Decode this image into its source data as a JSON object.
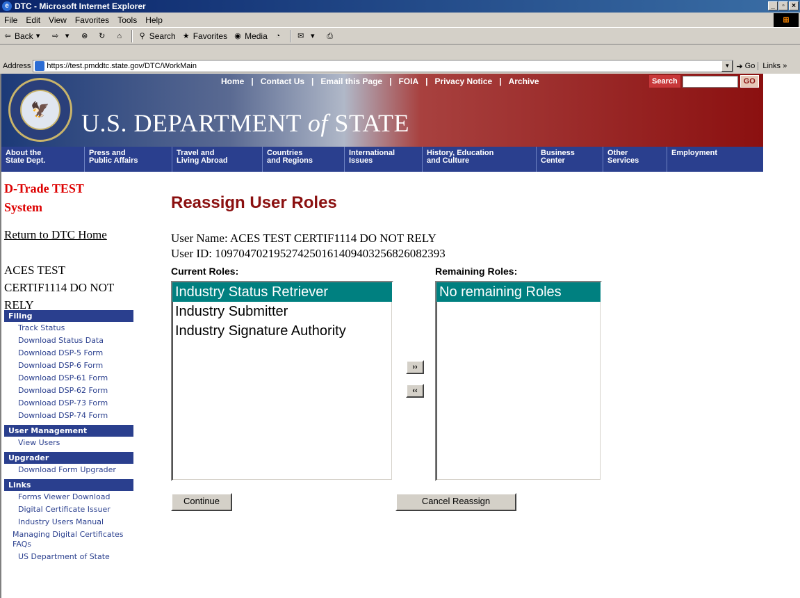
{
  "window": {
    "title": "DTC - Microsoft Internet Explorer",
    "controls": [
      "_",
      "□",
      "X"
    ]
  },
  "menu": [
    "File",
    "Edit",
    "View",
    "Favorites",
    "Tools",
    "Help"
  ],
  "toolbar": {
    "back": "Back",
    "search": "Search",
    "favorites": "Favorites",
    "media": "Media"
  },
  "address": {
    "label": "Address",
    "url": "https://test.pmddtc.state.gov/DTC/WorkMain",
    "go": "Go",
    "links": "Links »"
  },
  "banner": {
    "top_links": [
      "Home",
      "Contact Us",
      "Email this Page",
      "FOIA",
      "Privacy Notice",
      "Archive"
    ],
    "search_label": "Search",
    "search_go": "GO",
    "title_part1": "U.S. DEPARTMENT ",
    "title_of": "of",
    "title_part2": " STATE"
  },
  "nav": [
    "About the\nState Dept.",
    "Press and\nPublic Affairs",
    "Travel and\nLiving Abroad",
    "Countries\nand Regions",
    "International\nIssues",
    "History, Education\nand Culture",
    "Business\nCenter",
    "Other\nServices",
    "Employment"
  ],
  "sidebar": {
    "brand": "D-Trade TEST\nSystem",
    "return_link": "Return to DTC Home",
    "user_display": "ACES TEST CERTIF1114 DO NOT RELY",
    "sections": [
      {
        "head": "Filing",
        "items": [
          "Track Status",
          "Download Status Data",
          "Download DSP-5 Form",
          "Download DSP-6 Form",
          "Download DSP-61 Form",
          "Download DSP-62 Form",
          "Download DSP-73 Form",
          "Download DSP-74 Form"
        ]
      },
      {
        "head": "User Management",
        "items": [
          "View Users"
        ]
      },
      {
        "head": "Upgrader",
        "items": [
          "Download Form Upgrader"
        ]
      },
      {
        "head": "Links",
        "items": [
          "Forms Viewer Download",
          "Digital Certificate Issuer",
          "Industry Users Manual",
          "Managing Digital Certificates FAQs",
          "US Department of State"
        ]
      }
    ]
  },
  "main": {
    "title": "Reassign User Roles",
    "user_name_line": "User Name: ACES TEST CERTIF1114 DO NOT RELY",
    "user_id_line": "User ID: 1097047021952742501614094032568260823​93",
    "current_label": "Current Roles:",
    "remaining_label": "Remaining Roles:",
    "current_roles": [
      "Industry Status Retriever",
      "Industry Submitter",
      "Industry Signature Authority"
    ],
    "remaining_roles": [
      "No remaining Roles"
    ],
    "add_btn": "››",
    "remove_btn": "‹‹",
    "continue_btn": "Continue",
    "cancel_btn": "Cancel Reassign"
  },
  "colors": {
    "nav_bg": "#2a3f8e",
    "title_red": "#8b1010",
    "brand_red": "#dd0000",
    "selected": "#008080"
  }
}
